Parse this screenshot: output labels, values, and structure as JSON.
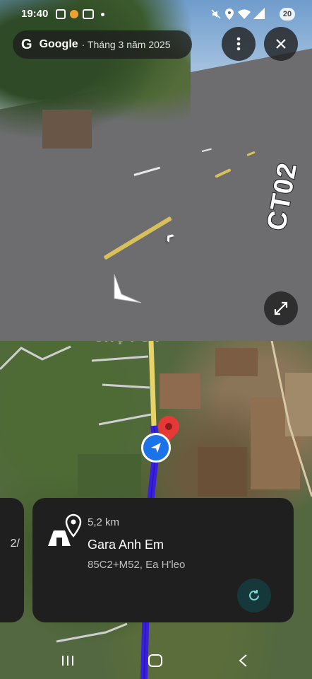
{
  "status_bar": {
    "time": "19:40",
    "badge": "20",
    "icons": [
      "image-icon",
      "notification-dot-icon",
      "video-icon",
      "mute-icon",
      "location-icon",
      "wifi-icon",
      "signal-icon",
      "battery-icon"
    ]
  },
  "street_view": {
    "brand": "Google",
    "date_label": "· Tháng 3 năm 2025",
    "road_marking": "CT02",
    "menu_icon": "more-vert-icon",
    "close_icon": "close-icon",
    "expand_icon": "fullscreen-icon"
  },
  "map": {
    "watermark": "chợTỐT",
    "route_color": "#3b1fe0",
    "pin_color": "#e53935",
    "position_color": "#1a73e8"
  },
  "card": {
    "distance": "5,2 km",
    "name": "Gara Anh Em",
    "address": "85C2+M52, Ea H'leo",
    "left_partial_text": "2/"
  },
  "nav_bar": {
    "icons": [
      "recent-apps-icon",
      "home-icon",
      "back-icon"
    ]
  }
}
